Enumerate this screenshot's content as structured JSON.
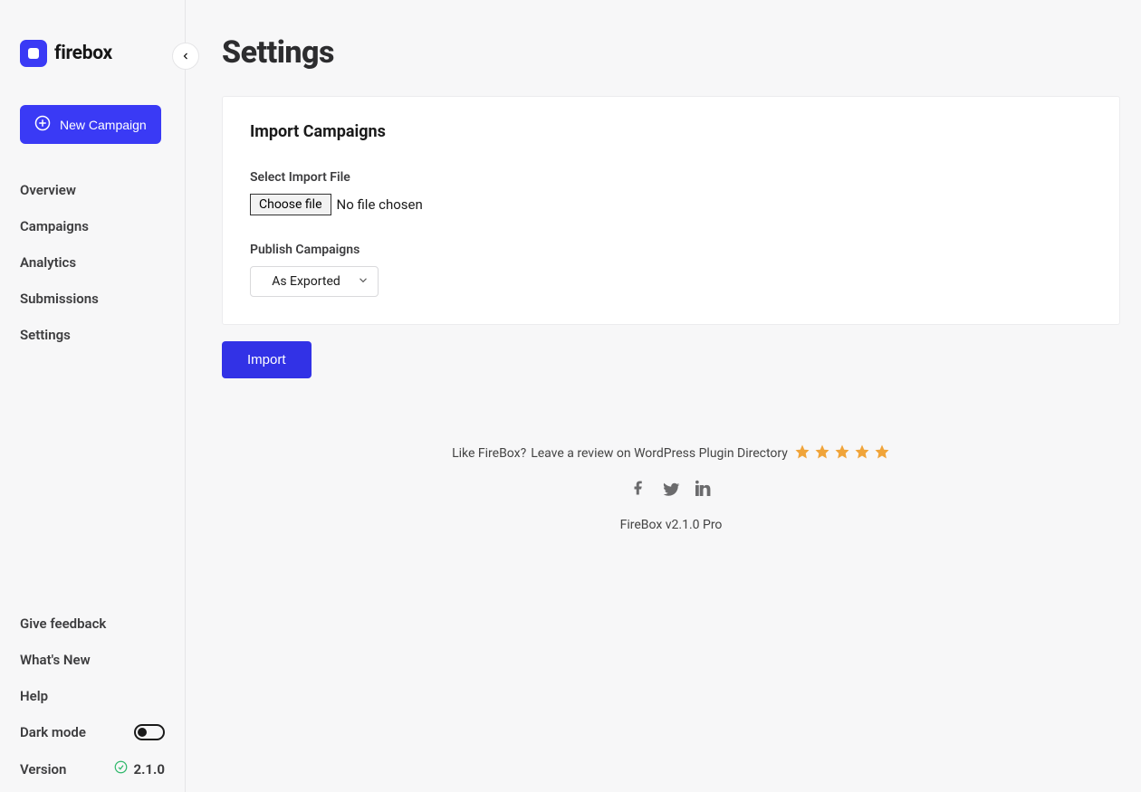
{
  "brand": {
    "name": "firebox"
  },
  "sidebar": {
    "new_campaign_label": "New Campaign",
    "nav": [
      {
        "label": "Overview"
      },
      {
        "label": "Campaigns"
      },
      {
        "label": "Analytics"
      },
      {
        "label": "Submissions"
      },
      {
        "label": "Settings"
      }
    ],
    "bottom": {
      "feedback": "Give feedback",
      "whats_new": "What's New",
      "help": "Help",
      "dark_mode": "Dark mode",
      "dark_mode_enabled": false,
      "version_label": "Version",
      "version_value": "2.1.0"
    }
  },
  "page": {
    "title": "Settings",
    "card_title": "Import Campaigns",
    "file_field_label": "Select Import File",
    "choose_file_label": "Choose file",
    "file_status": "No file chosen",
    "publish_field_label": "Publish Campaigns",
    "publish_selected": "As Exported",
    "import_button": "Import"
  },
  "footer": {
    "review_prefix": "Like FireBox?",
    "review_link": "Leave a review on WordPress Plugin Directory",
    "star_count": 5,
    "version_line": "FireBox v2.1.0 Pro"
  },
  "colors": {
    "accent": "#3a3af5",
    "star": "#f0a43a"
  }
}
